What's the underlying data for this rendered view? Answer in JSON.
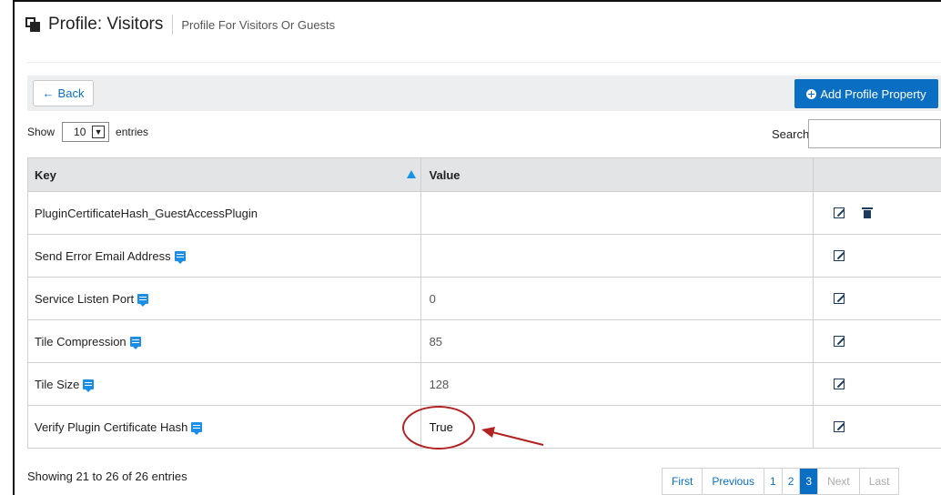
{
  "header": {
    "title": "Profile: Visitors",
    "subtitle": "Profile For Visitors Or Guests"
  },
  "toolbar": {
    "back_label": "Back",
    "back_arrow": "←",
    "add_label": "Add Profile Property"
  },
  "length_menu": {
    "prefix": "Show",
    "value": "10",
    "suffix": "entries"
  },
  "search": {
    "label": "Search:",
    "value": ""
  },
  "table": {
    "columns": [
      "Key",
      "Value",
      ""
    ],
    "rows": [
      {
        "key": "PluginCertificateHash_GuestAccessPlugin",
        "value": "",
        "has_comment": false,
        "has_delete": true
      },
      {
        "key": "Send Error Email Address",
        "value": "",
        "has_comment": true,
        "has_delete": false
      },
      {
        "key": "Service Listen Port",
        "value": "0",
        "has_comment": true,
        "has_delete": false
      },
      {
        "key": "Tile Compression",
        "value": "85",
        "has_comment": true,
        "has_delete": false
      },
      {
        "key": "Tile Size",
        "value": "128",
        "has_comment": true,
        "has_delete": false
      },
      {
        "key": "Verify Plugin Certificate Hash",
        "value": "True",
        "has_comment": true,
        "has_delete": false
      }
    ]
  },
  "info": "Showing 21 to 26 of 26 entries",
  "pagination": {
    "first": "First",
    "previous": "Previous",
    "pages": [
      "1",
      "2",
      "3"
    ],
    "current": "3",
    "next": "Next",
    "last": "Last"
  },
  "colors": {
    "accent": "#0a6fc2",
    "annotation": "#b22222",
    "header_bg": "#e3e4e6",
    "toolbar_bg": "#eceef0"
  },
  "icons": {
    "header": "profile-icon",
    "comment": "comment-icon",
    "edit": "edit-icon",
    "delete": "trash-icon",
    "add": "plus-circle-icon",
    "sort": "sort-asc-icon"
  }
}
